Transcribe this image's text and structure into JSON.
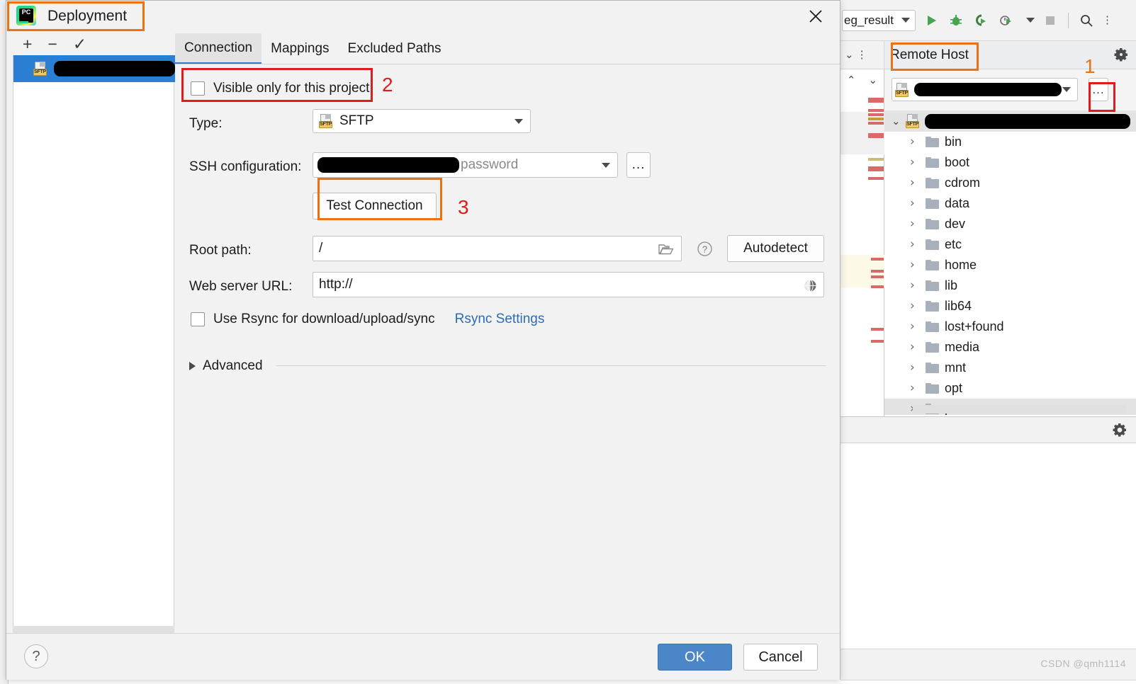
{
  "ide": {
    "run_config": "eg_result",
    "toolbar_icons": [
      "run-icon",
      "debug-icon",
      "coverage-icon",
      "profile-icon",
      "stop-icon",
      "search-icon",
      "kebab-icon"
    ],
    "tool_window": {
      "title": "Remote Host",
      "gear_icon": "gear-icon",
      "collapse_icon": "chevron-down-icon",
      "options_icon": "kebab-icon"
    },
    "remote_host_combo": {
      "value": "",
      "redacted": true,
      "browse_label": "...",
      "icon": "sftp-icon"
    },
    "tree": {
      "root_label": "",
      "root_redacted": true,
      "items": [
        "bin",
        "boot",
        "cdrom",
        "data",
        "dev",
        "etc",
        "home",
        "lib",
        "lib64",
        "lost+found",
        "media",
        "mnt",
        "opt",
        "proc"
      ]
    },
    "panel_footer_gear": "gear-icon",
    "watermark": "CSDN @qmh1114"
  },
  "dialog": {
    "title": "Deployment",
    "app_icon": "pycharm-icon",
    "close_icon": "close-icon",
    "left_toolbar": {
      "add_label": "+",
      "remove_label": "−",
      "use_default_label": "✓"
    },
    "server_list": [
      {
        "label": "",
        "redacted": true,
        "icon": "sftp-icon",
        "selected": true
      }
    ],
    "tabs": [
      {
        "label": "Connection",
        "active": true
      },
      {
        "label": "Mappings",
        "active": false
      },
      {
        "label": "Excluded Paths",
        "active": false
      }
    ],
    "fields": {
      "visible_only_label": "Visible only for this project",
      "visible_only_checked": false,
      "type_label": "Type:",
      "type_value": "SFTP",
      "type_icon": "sftp-icon",
      "ssh_config_label": "SSH configuration:",
      "ssh_config_value": "",
      "ssh_config_suffix": "password",
      "ssh_config_redacted": true,
      "ssh_browse_label": "...",
      "test_connection_label": "Test Connection",
      "root_path_label": "Root path:",
      "root_path_value": "/",
      "root_path_folder_icon": "folder-open-icon",
      "root_path_help_icon": "help-icon",
      "autodetect_label": "Autodetect",
      "web_url_label": "Web server URL:",
      "web_url_value": "http://",
      "web_url_icon": "globe-icon",
      "rsync_label": "Use Rsync for download/upload/sync",
      "rsync_checked": false,
      "rsync_settings_link": "Rsync Settings",
      "advanced_label": "Advanced",
      "advanced_expanded": false,
      "advanced_icon": "triangle-right-icon"
    },
    "footer": {
      "help_label": "?",
      "ok_label": "OK",
      "cancel_label": "Cancel"
    }
  },
  "annotations": {
    "orange": "#ec7211",
    "red": "#e01b1b",
    "markers": [
      {
        "number": "1",
        "color": "#ec7211",
        "target": "remote-host-browse-button"
      },
      {
        "number": "2",
        "color": "#e01b1b",
        "target": "visible-only-checkbox"
      },
      {
        "number": "3",
        "color": "#e01b1b",
        "target": "test-connection-button"
      }
    ]
  }
}
